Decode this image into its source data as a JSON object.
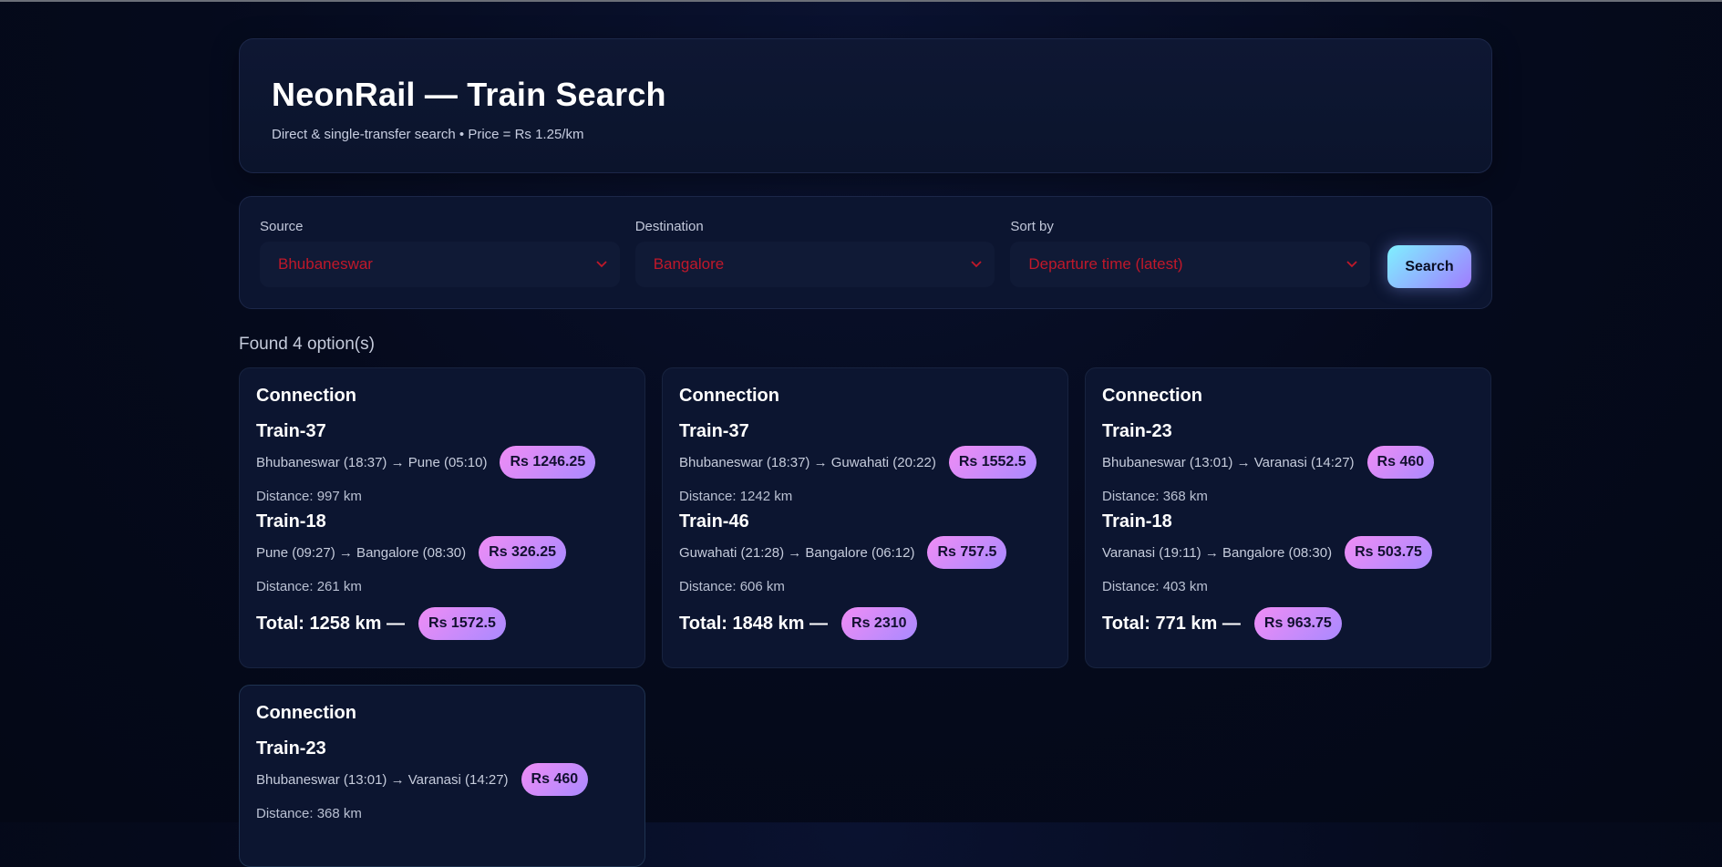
{
  "header": {
    "title": "NeonRail — Train Search",
    "subtitle": "Direct & single-transfer search • Price = Rs 1.25/km"
  },
  "form": {
    "source_label": "Source",
    "source_value": "Bhubaneswar",
    "destination_label": "Destination",
    "destination_value": "Bangalore",
    "sort_label": "Sort by",
    "sort_value": "Departure time (latest)",
    "search_label": "Search"
  },
  "results": {
    "summary": "Found 4 option(s)",
    "cards": [
      {
        "title": "Connection",
        "legs": [
          {
            "train": "Train-37",
            "route": "Bhubaneswar (18:37) → Pune (05:10)",
            "price": "Rs 1246.25",
            "distance": "Distance: 997 km"
          },
          {
            "train": "Train-18",
            "route": "Pune (09:27) → Bangalore (08:30)",
            "price": "Rs 326.25",
            "distance": "Distance: 261 km"
          }
        ],
        "total": "Total: 1258 km —",
        "total_price": "Rs 1572.5"
      },
      {
        "title": "Connection",
        "legs": [
          {
            "train": "Train-37",
            "route": "Bhubaneswar (18:37) → Guwahati (20:22)",
            "price": "Rs 1552.5",
            "distance": "Distance: 1242 km"
          },
          {
            "train": "Train-46",
            "route": "Guwahati (21:28) → Bangalore (06:12)",
            "price": "Rs 757.5",
            "distance": "Distance: 606 km"
          }
        ],
        "total": "Total: 1848 km —",
        "total_price": "Rs 2310"
      },
      {
        "title": "Connection",
        "legs": [
          {
            "train": "Train-23",
            "route": "Bhubaneswar (13:01) → Varanasi (14:27)",
            "price": "Rs 460",
            "distance": "Distance: 368 km"
          },
          {
            "train": "Train-18",
            "route": "Varanasi (19:11) → Bangalore (08:30)",
            "price": "Rs 503.75",
            "distance": "Distance: 403 km"
          }
        ],
        "total": "Total: 771 km —",
        "total_price": "Rs 963.75"
      },
      {
        "title": "Connection",
        "legs": [
          {
            "train": "Train-23",
            "route": "Bhubaneswar (13:01) → Varanasi (14:27)",
            "price": "Rs 460",
            "distance": "Distance: 368 km"
          }
        ]
      }
    ]
  },
  "colors": {
    "background": "#050a1c",
    "card": "#0c1530",
    "select_text": "#c0182a",
    "pill_gradient_start": "#f08cf5",
    "pill_gradient_end": "#a98aff",
    "button_gradient_start": "#7ff0ff",
    "button_gradient_end": "#a07cff"
  },
  "icons": {
    "select_arrow": "chevron-down-icon"
  }
}
